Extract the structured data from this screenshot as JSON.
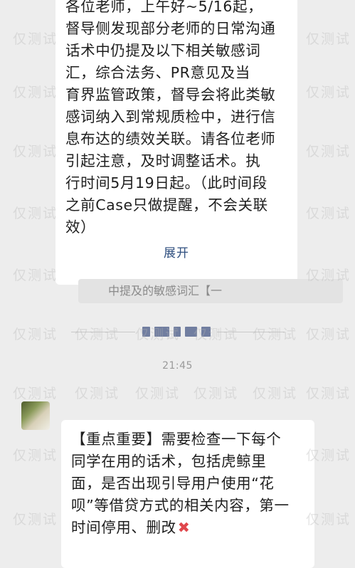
{
  "message1": {
    "lines": [
      "各位老师，上午好~5/16起，",
      "督导侧发现部分老师的日常沟通",
      "话术中仍提及以下相关敏感词",
      "汇，综合法务、PR意见及当",
      "育界监管政策，督导会将此类敏",
      "感词纳入到常规质检中，进行信",
      "息布达的绩效关联。请各位老师",
      "引起注意，及时调整话术。执",
      "行时间5月19日起。（此时间段",
      "之前Case只做提醒，不会关联",
      "效）"
    ],
    "expand_label": "展开",
    "quoted_text": "中提及的敏感词汇【一"
  },
  "timestamp": "21:45",
  "message2": {
    "lines": [
      "【重点重要】需要检查一下每个",
      "同学在用的话术，包括虎鲸里",
      "面，是否出现引导用户使用“花",
      "呗”等借贷方式的相关内容，第一",
      "时间停用、删改"
    ],
    "end_icon": "red-x-icon"
  },
  "watermark": "仅测试",
  "colors": {
    "background": "#ededed",
    "bubble": "#ffffff",
    "link": "#2f4f7f",
    "error": "#e0474c"
  }
}
